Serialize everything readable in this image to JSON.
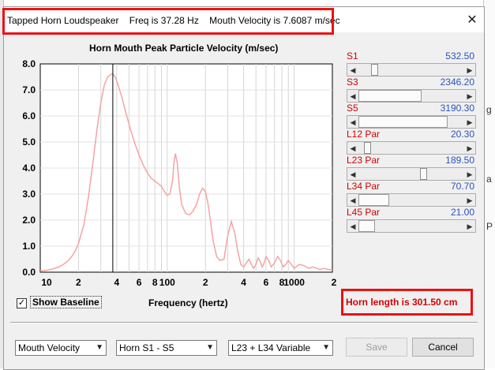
{
  "window": {
    "title_app": "Tapped Horn Loudspeaker",
    "title_freq": "Freq is 37.28 Hz",
    "title_velocity": "Mouth Velocity is 7.6087 m/sec",
    "close_glyph": "✕"
  },
  "background_right": {
    "chars": [
      "g",
      "a",
      "P"
    ]
  },
  "chart_data": {
    "type": "line",
    "title": "Horn Mouth Peak Particle Velocity (m/sec)",
    "xlabel": "Frequency (hertz)",
    "ylabel": "",
    "x_scale": "log",
    "xlim": [
      10,
      2000
    ],
    "ylim": [
      0,
      8
    ],
    "y_ticks": [
      "0.0",
      "1.0",
      "2.0",
      "3.0",
      "4.0",
      "5.0",
      "6.0",
      "7.0",
      "8.0"
    ],
    "x_ticks": [
      {
        "value": 10,
        "label": "10"
      },
      {
        "value": 20,
        "label": "2"
      },
      {
        "value": 40,
        "label": "4"
      },
      {
        "value": 60,
        "label": "6"
      },
      {
        "value": 80,
        "label": "8"
      },
      {
        "value": 100,
        "label": "100"
      },
      {
        "value": 200,
        "label": "2"
      },
      {
        "value": 400,
        "label": "4"
      },
      {
        "value": 600,
        "label": "6"
      },
      {
        "value": 800,
        "label": "8"
      },
      {
        "value": 1000,
        "label": "1000"
      },
      {
        "value": 2000,
        "label": "2"
      }
    ],
    "grid": true,
    "cursor_x": 37.28,
    "line_color": "#f4a4a4",
    "series": [
      {
        "name": "",
        "x": [
          10,
          11,
          12,
          13,
          14,
          15,
          16,
          17,
          18,
          19,
          20,
          22,
          24,
          26,
          28,
          30,
          32,
          34,
          36,
          37.28,
          39,
          41,
          44,
          48,
          52,
          56,
          60,
          65,
          70,
          75,
          80,
          85,
          90,
          95,
          100,
          105,
          110,
          113,
          116,
          120,
          125,
          130,
          140,
          150,
          160,
          170,
          180,
          190,
          200,
          210,
          220,
          230,
          245,
          260,
          280,
          300,
          320,
          340,
          360,
          380,
          400,
          420,
          440,
          460,
          480,
          500,
          520,
          540,
          560,
          580,
          600,
          630,
          660,
          700,
          740,
          780,
          820,
          860,
          900,
          950,
          1000,
          1100,
          1200,
          1300,
          1400,
          1500,
          1600,
          1700,
          1800,
          1900,
          2000
        ],
        "values": [
          0.05,
          0.07,
          0.1,
          0.15,
          0.2,
          0.28,
          0.38,
          0.5,
          0.65,
          0.85,
          1.1,
          1.8,
          2.9,
          4.2,
          5.5,
          6.5,
          7.2,
          7.5,
          7.6,
          7.61,
          7.5,
          7.2,
          6.7,
          6.0,
          5.4,
          4.9,
          4.5,
          4.1,
          3.8,
          3.6,
          3.5,
          3.4,
          3.3,
          3.1,
          2.95,
          3.0,
          3.5,
          4.2,
          4.55,
          4.2,
          3.2,
          2.6,
          2.25,
          2.2,
          2.35,
          2.6,
          3.0,
          3.22,
          3.1,
          2.6,
          1.9,
          1.2,
          0.6,
          0.45,
          0.5,
          1.4,
          1.95,
          1.5,
          0.8,
          0.3,
          0.2,
          0.35,
          0.5,
          0.3,
          0.15,
          0.3,
          0.55,
          0.4,
          0.2,
          0.35,
          0.6,
          0.45,
          0.2,
          0.35,
          0.6,
          0.45,
          0.2,
          0.3,
          0.45,
          0.3,
          0.15,
          0.3,
          0.25,
          0.15,
          0.2,
          0.15,
          0.1,
          0.15,
          0.12,
          0.1,
          0.08
        ]
      }
    ]
  },
  "sliders": [
    {
      "id": "s1",
      "label": "S1",
      "value": "532.50",
      "fraction": 0.12,
      "wide": false
    },
    {
      "id": "s3",
      "label": "S3",
      "value": "2346.20",
      "fraction": 0.5,
      "wide": true
    },
    {
      "id": "s5",
      "label": "S5",
      "value": "3190.30",
      "fraction": 0.75,
      "wide": true
    },
    {
      "id": "l12",
      "label": "L12  Par",
      "value": "20.30",
      "fraction": 0.05,
      "wide": false
    },
    {
      "id": "l23",
      "label": "L23  Par",
      "value": "189.50",
      "fraction": 0.59,
      "wide": false
    },
    {
      "id": "l34",
      "label": "L34  Par",
      "value": "70.70",
      "fraction": 0.19,
      "wide": true
    },
    {
      "id": "l45",
      "label": "L45  Par",
      "value": "21.00",
      "fraction": 0.05,
      "wide": true
    }
  ],
  "baseline": {
    "label": "Show Baseline",
    "checked": true,
    "check_glyph": "✓"
  },
  "horn_length": "Horn length is 301.50 cm",
  "dropdowns": {
    "plot_type": "Mouth Velocity",
    "horn_range": "Horn S1 - S5",
    "variable": "L23 + L34 Variable"
  },
  "buttons": {
    "save": "Save",
    "cancel": "Cancel"
  },
  "colors": {
    "accent_red": "#ee1111",
    "label_red": "#d40000",
    "value_blue": "#2a52be"
  }
}
